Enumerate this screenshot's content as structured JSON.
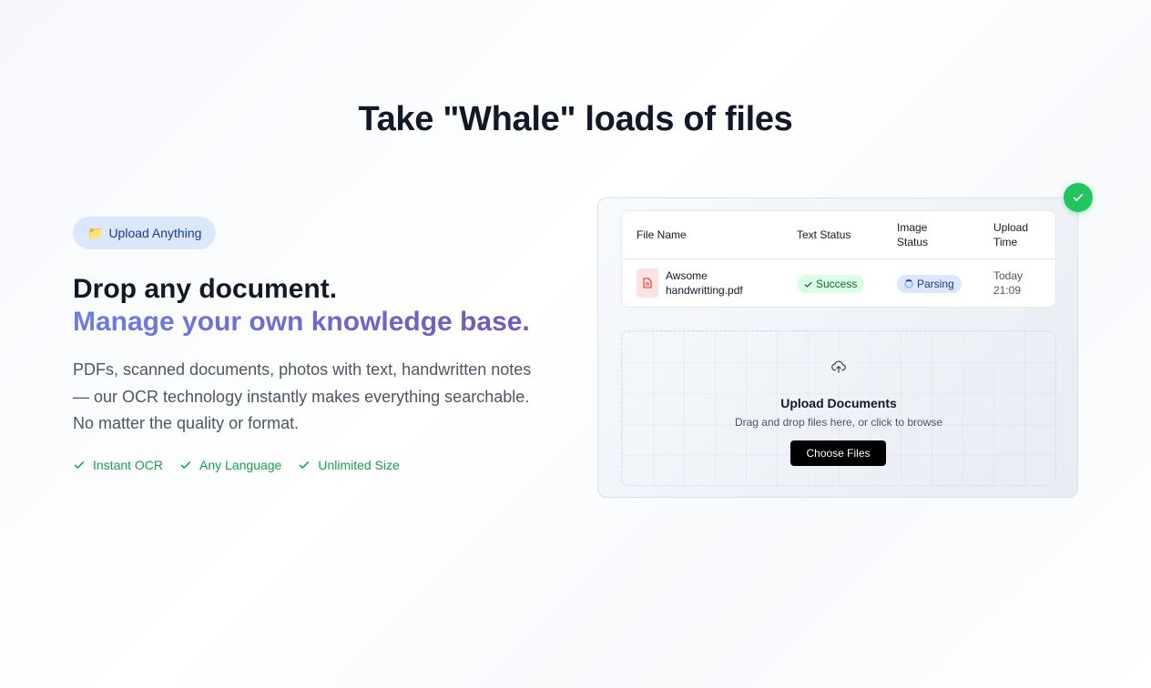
{
  "headline": "Take \"Whale\" loads of files",
  "pill": {
    "icon": "folder-icon",
    "label": "Upload Anything"
  },
  "heading_line1": "Drop any document.",
  "heading_line2": "Manage your own knowledge base.",
  "description": "PDFs, scanned documents, photos with text, handwritten notes — our OCR technology instantly makes everything searchable. No matter the quality or format.",
  "features": [
    {
      "icon": "check-icon",
      "label": "Instant OCR"
    },
    {
      "icon": "check-icon",
      "label": "Any Language"
    },
    {
      "icon": "check-icon",
      "label": "Unlimited Size"
    }
  ],
  "table": {
    "headers": {
      "file_name": "File Name",
      "text_status": "Text Status",
      "image_status_l1": "Image",
      "image_status_l2": "Status",
      "upload_time_l1": "Upload",
      "upload_time_l2": "Time"
    },
    "rows": [
      {
        "file_l1": "Awsome",
        "file_l2": "handwritting.pdf",
        "text_status": "Success",
        "image_status": "Parsing",
        "time_l1": "Today",
        "time_l2": "21:09"
      }
    ]
  },
  "upload": {
    "title": "Upload Documents",
    "subtitle": "Drag and drop files here, or click to browse",
    "button": "Choose Files"
  },
  "colors": {
    "success": "#22c55e",
    "accent_start": "#6b7fe0",
    "accent_end": "#7653b5",
    "feature_green": "#16a34a"
  }
}
